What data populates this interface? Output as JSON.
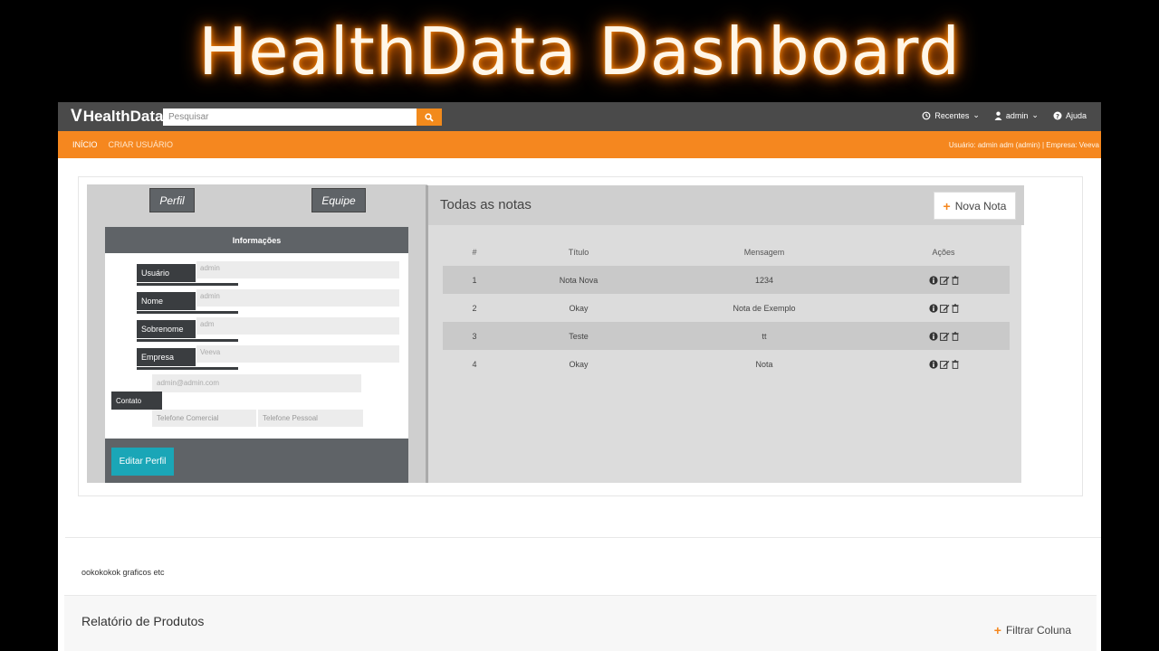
{
  "banner": {
    "title": "HealthData Dashboard"
  },
  "topbar": {
    "logo_mark": "V",
    "logo_text": "HealthData",
    "search_placeholder": "Pesquisar",
    "recent_label": "Recentes",
    "user_label": "admin",
    "help_label": "Ajuda"
  },
  "nav": {
    "items": [
      "INÍCIO",
      "CRIAR USUÁRIO"
    ],
    "user_info": "Usuário: admin adm (admin) | Empresa: Veeva"
  },
  "profile": {
    "tab_perfil": "Perfil",
    "tab_equipe": "Equipe",
    "info_heading": "Informações",
    "fields": [
      {
        "label": "Usuário",
        "value": "admin"
      },
      {
        "label": "Nome",
        "value": "admin"
      },
      {
        "label": "Sobrenome",
        "value": "adm"
      },
      {
        "label": "Empresa",
        "value": "Veeva"
      }
    ],
    "contact_label": "Contato",
    "email_value": "admin@admin.com",
    "phone_business_placeholder": "Telefone Comercial",
    "phone_personal_placeholder": "Telefone Pessoal",
    "edit_button": "Editar Perfil"
  },
  "notes": {
    "title": "Todas as notas",
    "new_button": "Nova Nota",
    "columns": [
      "#",
      "Título",
      "Mensagem",
      "Ações"
    ],
    "rows": [
      {
        "id": "1",
        "title": "Nota Nova",
        "message": "1234"
      },
      {
        "id": "2",
        "title": "Okay",
        "message": "Nota de Exemplo"
      },
      {
        "id": "3",
        "title": "Teste",
        "message": "tt"
      },
      {
        "id": "4",
        "title": "Okay",
        "message": "Nota"
      }
    ]
  },
  "misc_text": "ookokokok graficos etc",
  "report": {
    "title": "Relatório de Produtos",
    "filter_label": "Filtrar Coluna"
  }
}
